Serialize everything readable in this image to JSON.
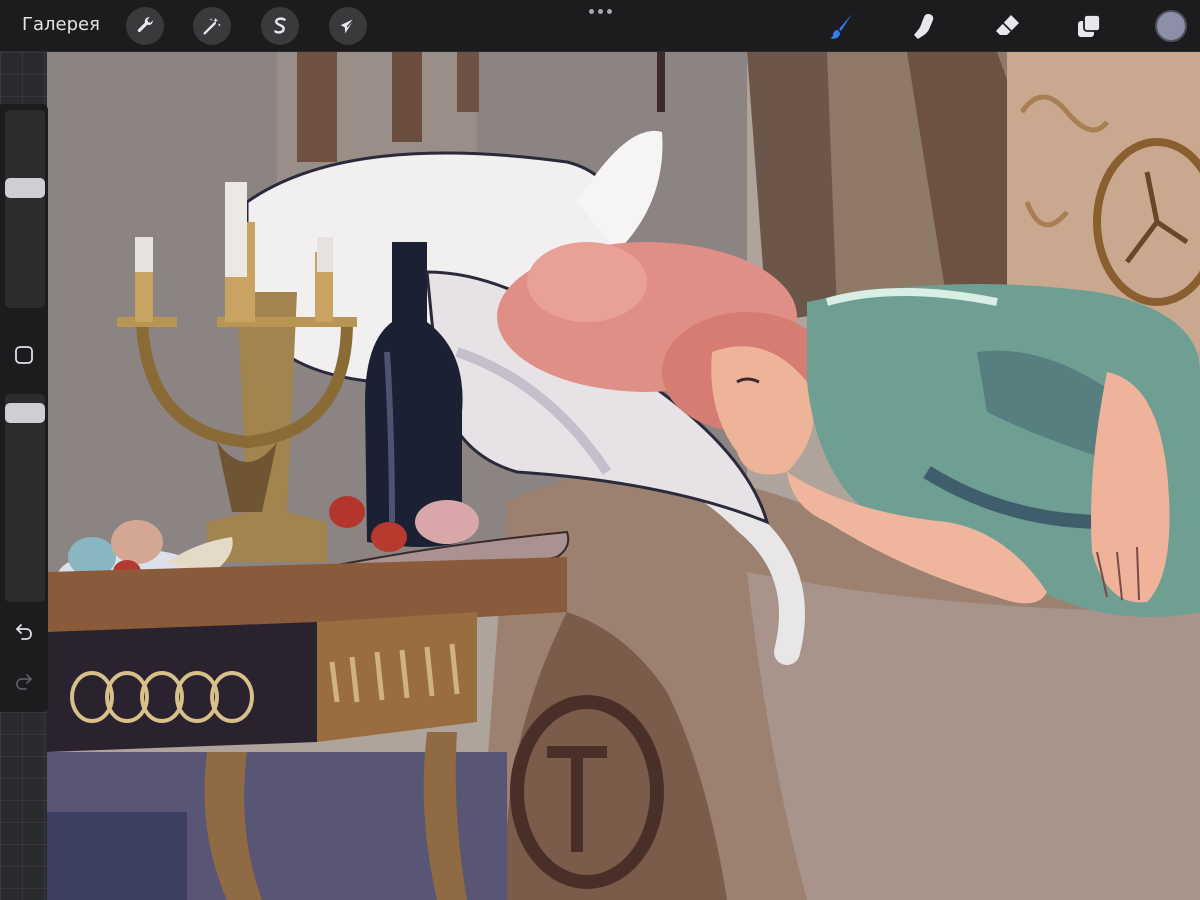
{
  "topbar": {
    "gallery_label": "Галерея",
    "left_tools": [
      {
        "name": "actions-tool",
        "icon": "wrench-icon"
      },
      {
        "name": "adjustments-tool",
        "icon": "magic-wand-icon"
      },
      {
        "name": "selection-tool",
        "icon": "selection-s-icon"
      },
      {
        "name": "transform-tool",
        "icon": "arrow-cursor-icon"
      }
    ],
    "right_tools": [
      {
        "name": "brush-tool",
        "icon": "brush-icon",
        "active": true
      },
      {
        "name": "smudge-tool",
        "icon": "smudge-finger-icon",
        "active": false
      },
      {
        "name": "eraser-tool",
        "icon": "eraser-icon",
        "active": false
      },
      {
        "name": "layers-tool",
        "icon": "layers-icon",
        "active": false
      }
    ],
    "current_color": "#8d8fa8",
    "active_tool_color": "#2f7ff3"
  },
  "sidebar": {
    "brush_size_level": 0.62,
    "brush_opacity_level": 0.95,
    "icons": [
      "modify-square-icon",
      "undo-icon",
      "redo-icon"
    ]
  },
  "canvas": {
    "background_color": "#b8aa9f"
  }
}
